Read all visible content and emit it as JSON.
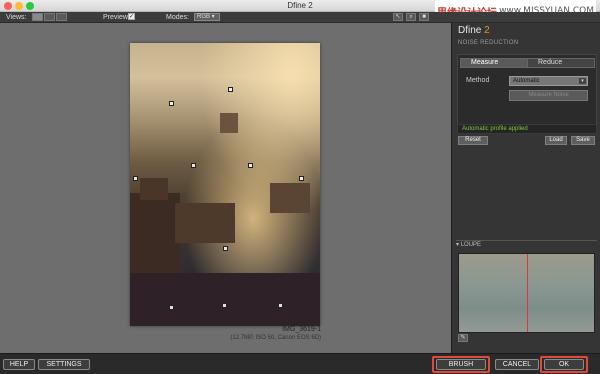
{
  "window": {
    "title": "Dfine 2"
  },
  "watermark": {
    "site": "思缘设计论坛",
    "url": "www.MISSYUAN.COM"
  },
  "toolbar": {
    "views_label": "Views:",
    "preview_label": "Preview:",
    "preview_checked": "✓",
    "modes_label": "Modes:",
    "mode_value": "RGB"
  },
  "image": {
    "filename": "IMG_3619-1",
    "meta": "(12.7MP, ISO 50, Canon EOS 6D)"
  },
  "sidebar": {
    "logo_name": "Dfine",
    "logo_version": "2",
    "section": "NOISE REDUCTION",
    "tabs": {
      "measure": "Measure",
      "reduce": "Reduce"
    },
    "method_label": "Method",
    "method_value": "Automatic",
    "measure_noise": "Measure Noise",
    "status": "Automatic profile applied",
    "reset": "Reset",
    "load": "Load",
    "save": "Save",
    "loupe": "LOUPE"
  },
  "footer": {
    "help": "HELP",
    "settings": "SETTINGS",
    "brush": "BRUSH",
    "cancel": "CANCEL",
    "ok": "OK"
  },
  "colors": {
    "status_green": "#7fc837",
    "accent_orange": "#e39321",
    "highlight_red": "#e04a3a"
  }
}
